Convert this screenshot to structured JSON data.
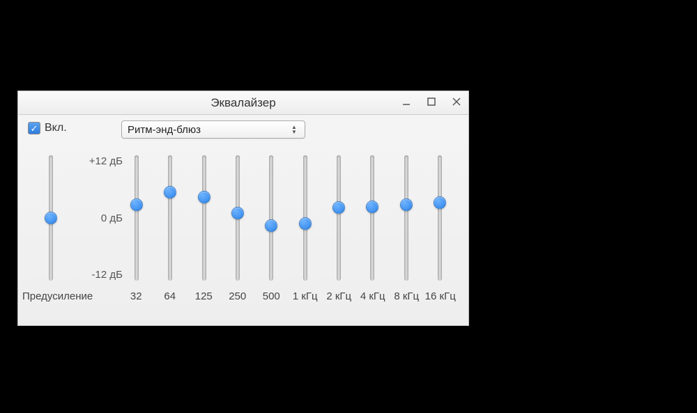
{
  "window": {
    "title": "Эквалайзер"
  },
  "enable": {
    "label": "Вкл.",
    "checked": true
  },
  "preset": {
    "selected": "Ритм-энд-блюз"
  },
  "db": {
    "max": "+12 дБ",
    "zero": "0 дБ",
    "min": "-12 дБ"
  },
  "preamp": {
    "label": "Предусиление",
    "value_db": 0
  },
  "bands": [
    {
      "label": "32",
      "value_db": 2.5
    },
    {
      "label": "64",
      "value_db": 5.0
    },
    {
      "label": "125",
      "value_db": 4.0
    },
    {
      "label": "250",
      "value_db": 1.0
    },
    {
      "label": "500",
      "value_db": -1.5
    },
    {
      "label": "1 кГц",
      "value_db": -1.0
    },
    {
      "label": "2 кГц",
      "value_db": 2.0
    },
    {
      "label": "4 кГц",
      "value_db": 2.2
    },
    {
      "label": "8 кГц",
      "value_db": 2.5
    },
    {
      "label": "16 кГц",
      "value_db": 3.0
    }
  ],
  "slider_range": {
    "min": -12,
    "max": 12
  }
}
